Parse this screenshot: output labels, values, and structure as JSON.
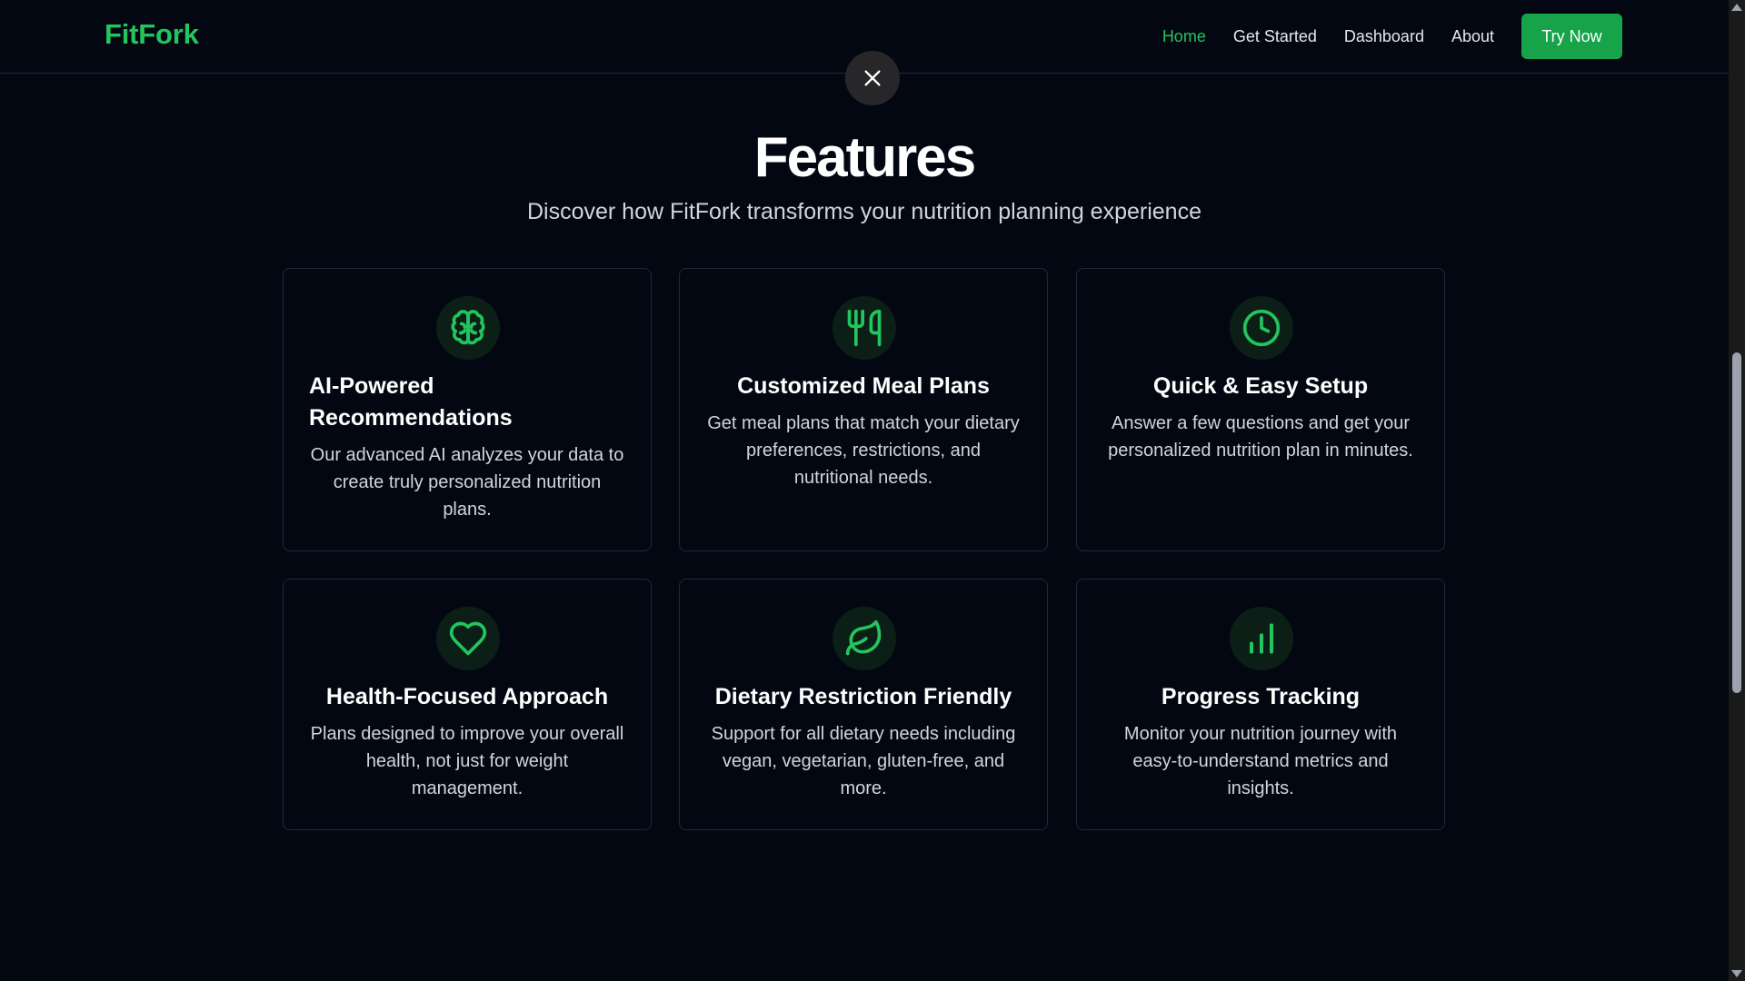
{
  "brand": "FitFork",
  "nav": {
    "home": "Home",
    "get_started": "Get Started",
    "dashboard": "Dashboard",
    "about": "About",
    "try_now": "Try Now"
  },
  "section": {
    "title": "Features",
    "subtitle": "Discover how FitFork transforms your nutrition planning experience"
  },
  "features": [
    {
      "icon": "brain-icon",
      "title": "AI-Powered Recommendations",
      "description": "Our advanced AI analyzes your data to create truly personalized nutrition plans."
    },
    {
      "icon": "utensils-icon",
      "title": "Customized Meal Plans",
      "description": "Get meal plans that match your dietary preferences, restrictions, and nutritional needs."
    },
    {
      "icon": "clock-icon",
      "title": "Quick & Easy Setup",
      "description": "Answer a few questions and get your personalized nutrition plan in minutes."
    },
    {
      "icon": "heart-icon",
      "title": "Health-Focused Approach",
      "description": "Plans designed to improve your overall health, not just for weight management."
    },
    {
      "icon": "leaf-icon",
      "title": "Dietary Restriction Friendly",
      "description": "Support for all dietary needs including vegan, vegetarian, gluten-free, and more."
    },
    {
      "icon": "bar-chart-icon",
      "title": "Progress Tracking",
      "description": "Monitor your nutrition journey with easy-to-understand metrics and insights."
    }
  ],
  "colors": {
    "accent": "#22c55e",
    "button": "#16a34a",
    "background": "#030712"
  }
}
